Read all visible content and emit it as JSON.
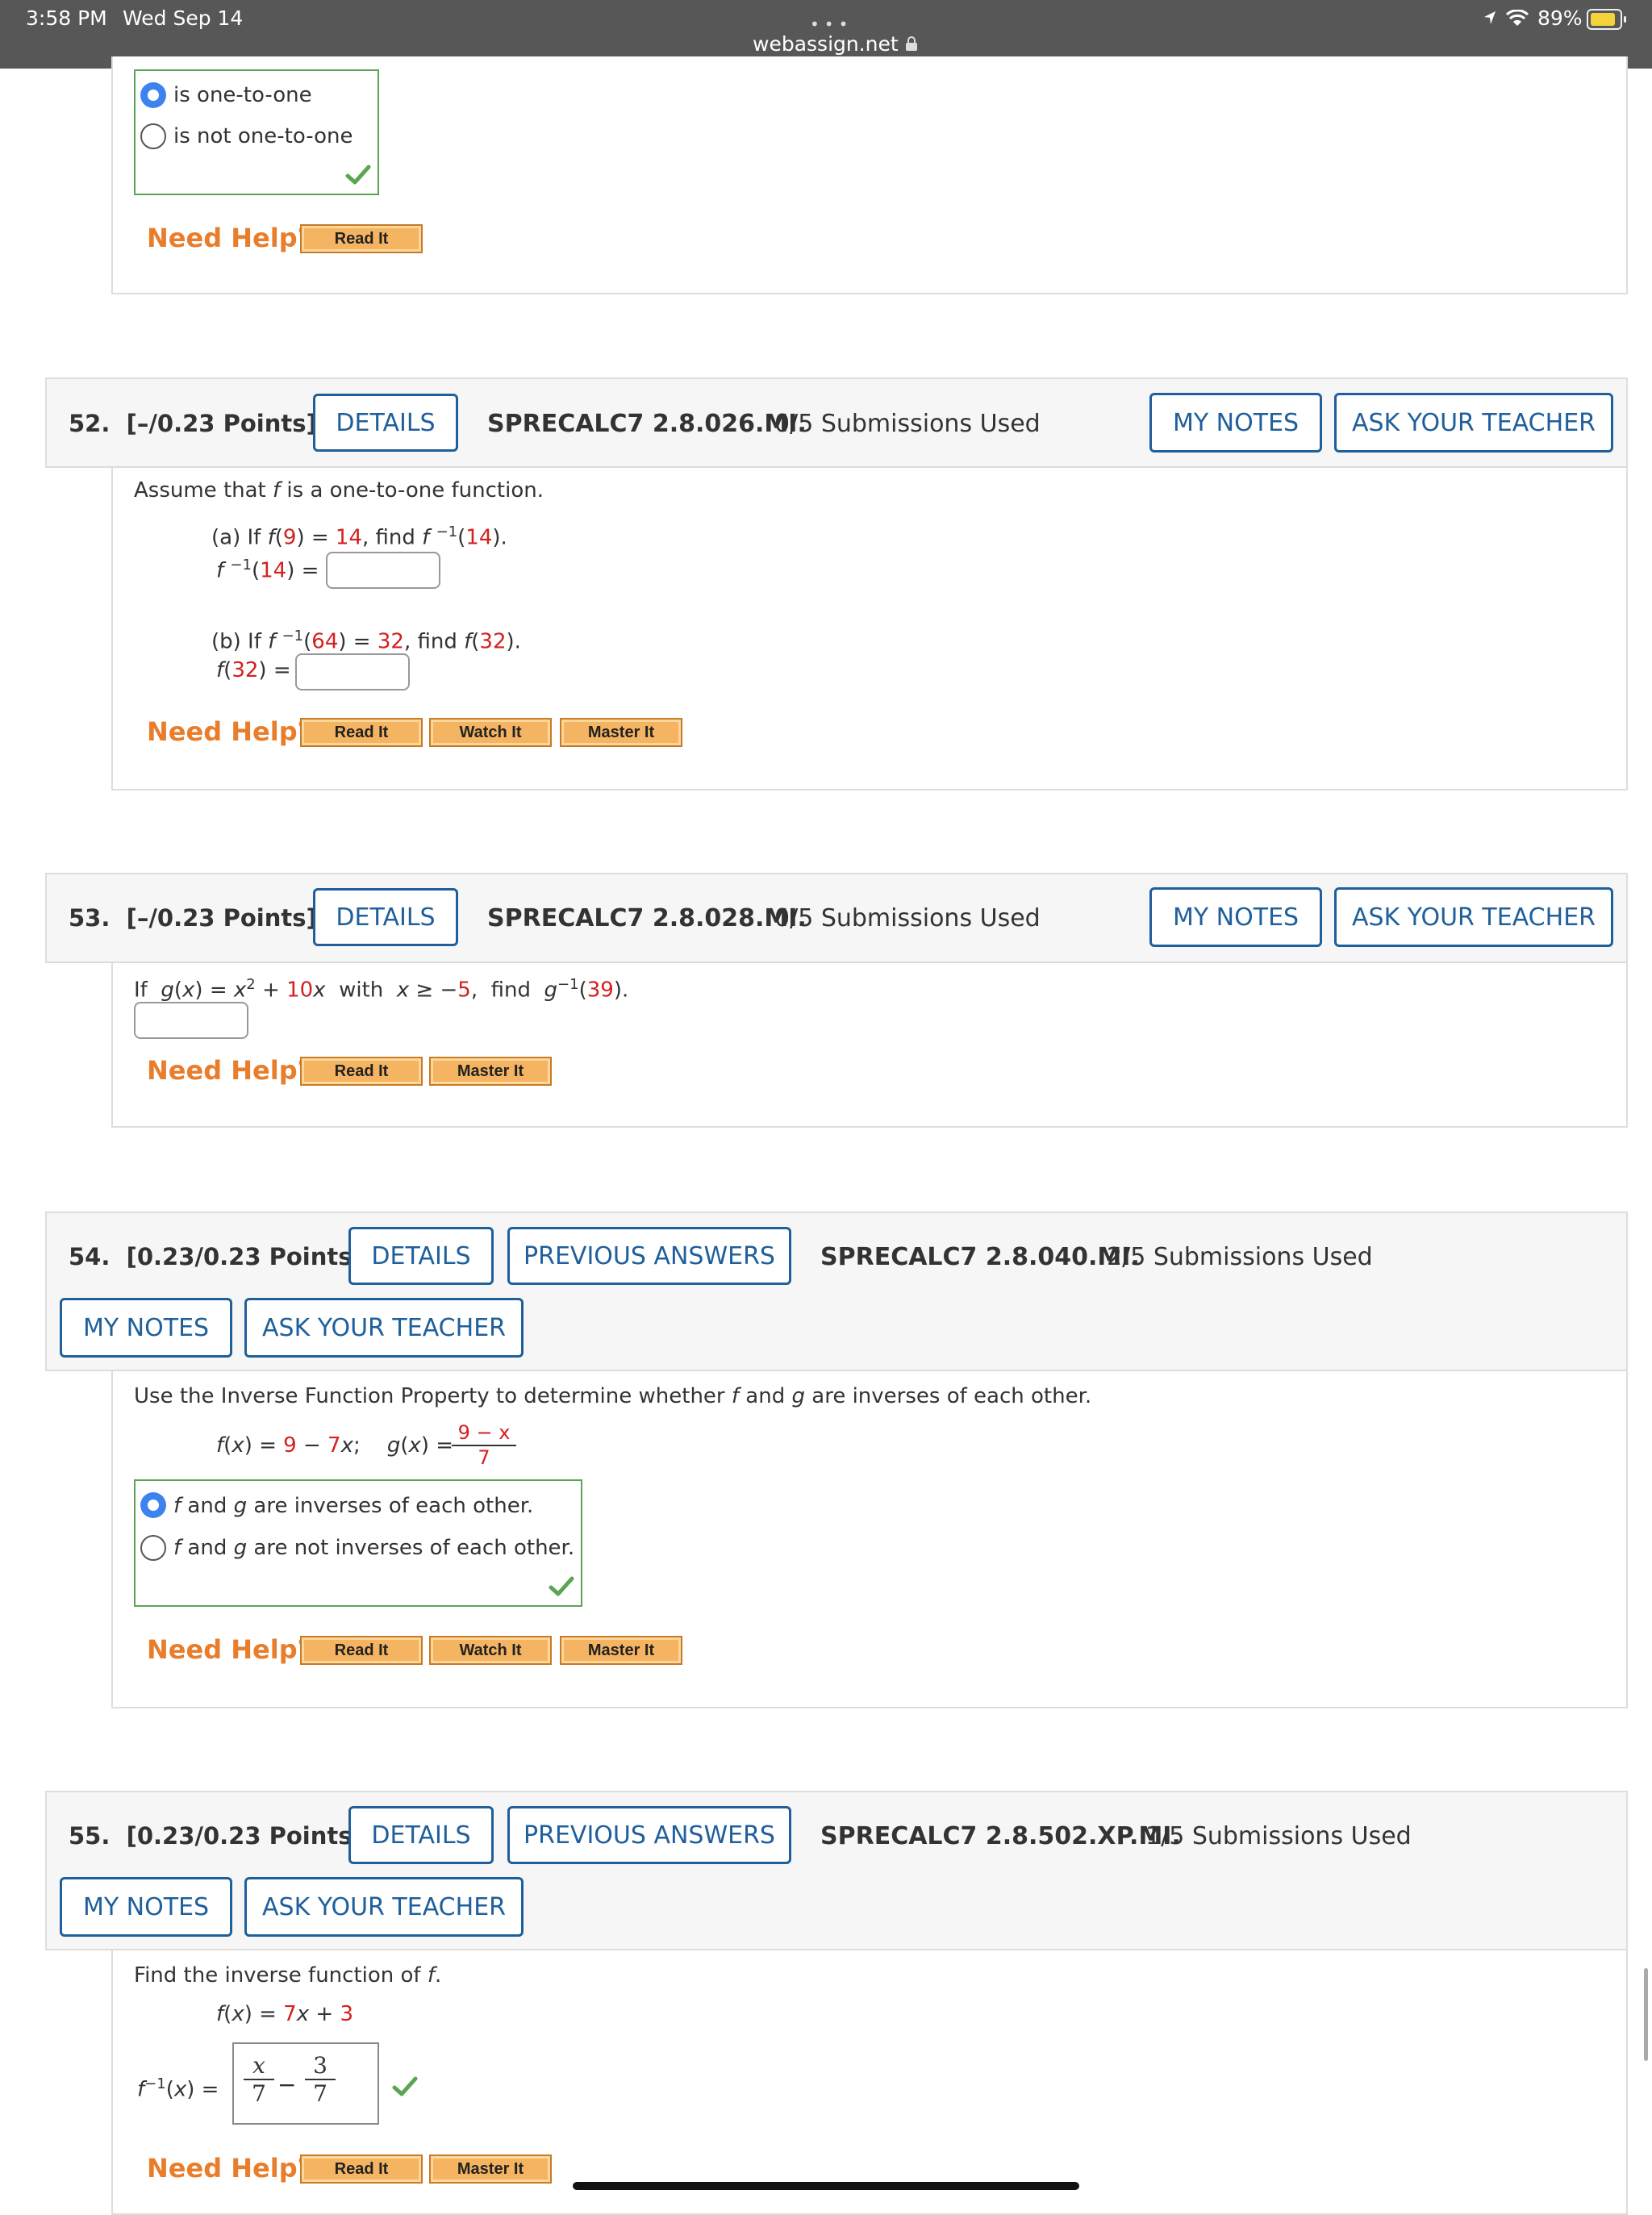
{
  "status": {
    "time": "3:58 PM",
    "date": "Wed Sep 14",
    "url": "webassign.net",
    "battery": "89%",
    "battery_level": 0.89
  },
  "q51": {
    "choices": [
      "is one-to-one",
      "is not one-to-one"
    ],
    "selected": 0
  },
  "help": {
    "label": "Need Help?",
    "read": "Read It",
    "watch": "Watch It",
    "master": "Master It"
  },
  "buttons": {
    "details": "DETAILS",
    "notes": "MY NOTES",
    "ask": "ASK YOUR TEACHER",
    "previous": "PREVIOUS ANSWERS"
  },
  "q52": {
    "number": "52.",
    "points": "[–/0.23 Points]",
    "code": "SPRECALC7 2.8.026.MI.",
    "submissions": "0/5 Submissions Used",
    "intro_a": "Assume that ",
    "intro_f": "f",
    "intro_b": " is a one-to-one function.",
    "a_label": "(a) If ",
    "a_val1": "9",
    "a_val2": "14",
    "a_find": ", find ",
    "a_val3": "14",
    "b_label": "(b) If ",
    "b_val1": "64",
    "b_val2": "32",
    "b_val3": "32"
  },
  "q53": {
    "number": "53.",
    "points": "[–/0.23 Points]",
    "code": "SPRECALC7 2.8.028.MI.",
    "submissions": "0/5 Submissions Used",
    "coef": "10",
    "bound": "5",
    "target": "39"
  },
  "q54": {
    "number": "54.",
    "points": "[0.23/0.23 Points]",
    "code": "SPRECALC7 2.8.040.MI.",
    "submissions": "2/5 Submissions Used",
    "intro": "Use the Inverse Function Property to determine whether f and g are inverses of each other.",
    "f_const": "9",
    "f_coef": "7",
    "g_num": "9 − x",
    "g_den": "7",
    "choices": [
      "f and g are inverses of each other.",
      "f and g are not inverses of each other."
    ],
    "selected": 0
  },
  "q55": {
    "number": "55.",
    "points": "[0.23/0.23 Points]",
    "code": "SPRECALC7 2.8.502.XP.MI.",
    "submissions": "1/5 Submissions Used",
    "intro": "Find the inverse function of f.",
    "f_coef": "7",
    "f_const": "3",
    "ans_num1": "x",
    "ans_den1": "7",
    "ans_num2": "3",
    "ans_den2": "7"
  }
}
